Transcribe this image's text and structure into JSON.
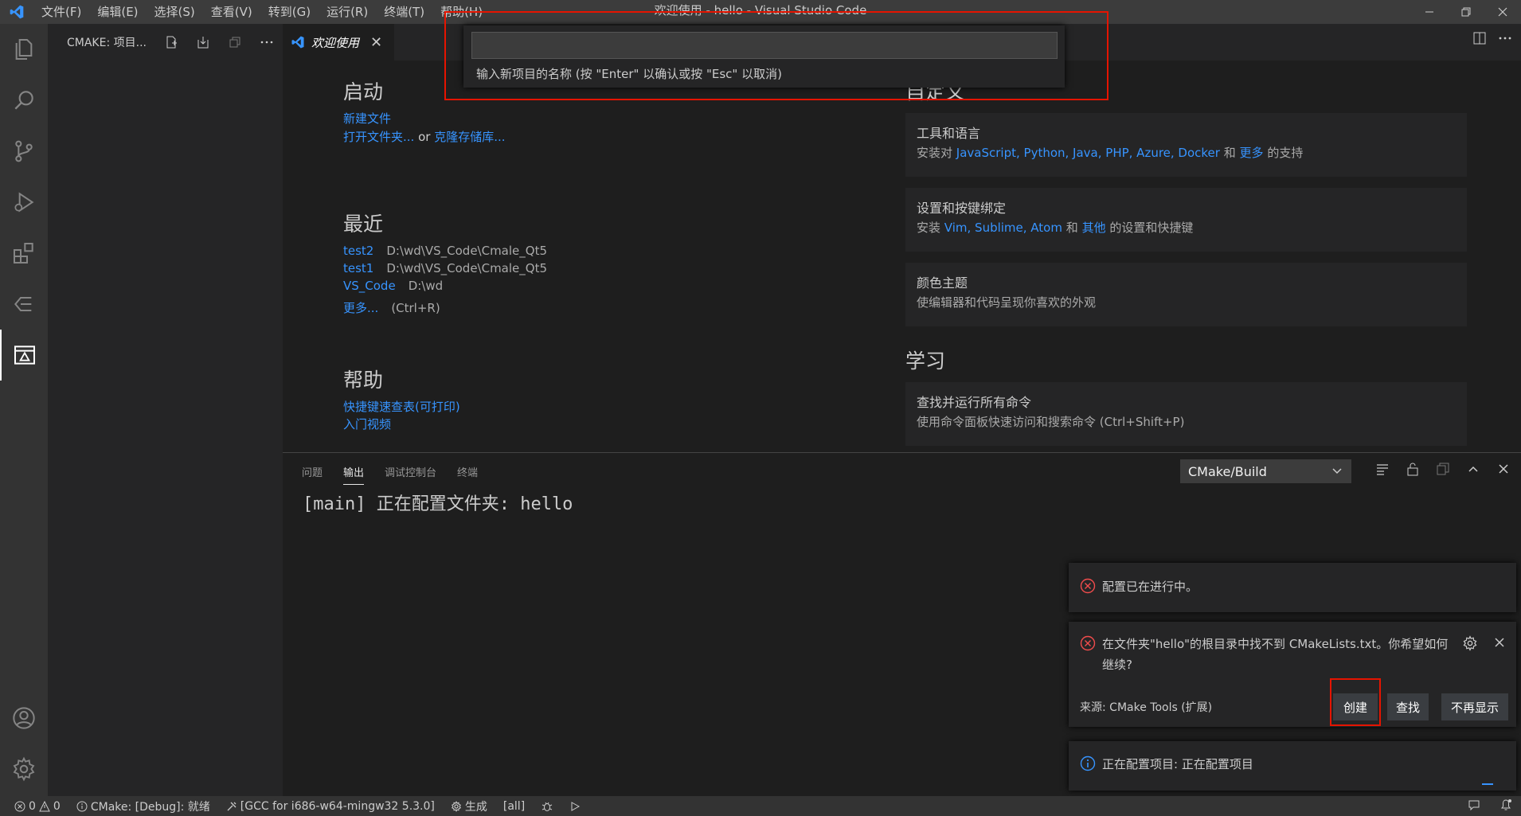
{
  "titlebar": {
    "title": "欢迎使用 - hello - Visual Studio Code",
    "menu": [
      "文件(F)",
      "编辑(E)",
      "选择(S)",
      "查看(V)",
      "转到(G)",
      "运行(R)",
      "终端(T)",
      "帮助(H)"
    ]
  },
  "sidebar": {
    "title": "CMAKE: 项目..."
  },
  "tab": {
    "label": "欢迎使用"
  },
  "quick_input": {
    "value": "",
    "message": "输入新项目的名称 (按 \"Enter\" 以确认或按 \"Esc\" 以取消)"
  },
  "welcome": {
    "start": {
      "title": "启动",
      "new_file": "新建文件",
      "open_folder": "打开文件夹...",
      "or": "or",
      "clone_repo": "克隆存储库..."
    },
    "recent": {
      "title": "最近",
      "items": [
        {
          "name": "test2",
          "path": "D:\\wd\\VS_Code\\Cmale_Qt5"
        },
        {
          "name": "test1",
          "path": "D:\\wd\\VS_Code\\Cmale_Qt5"
        },
        {
          "name": "VS_Code",
          "path": "D:\\wd"
        }
      ],
      "more": "更多...",
      "more_shortcut": "(Ctrl+R)"
    },
    "help": {
      "title": "帮助",
      "cheatsheet": "快捷键速查表(可打印)",
      "intro_videos": "入门视频"
    },
    "customize": {
      "title": "自定义",
      "cards": [
        {
          "title": "工具和语言",
          "desc_prefix": "安装对",
          "links": "JavaScript, Python, Java, PHP, Azure, Docker",
          "and": "和",
          "more": "更多",
          "desc_suffix": "的支持"
        },
        {
          "title": "设置和按键绑定",
          "desc_prefix": "安装",
          "links": "Vim, Sublime, Atom",
          "and": "和",
          "more": "其他",
          "desc_suffix": "的设置和快捷键"
        },
        {
          "title": "颜色主题",
          "desc": "使编辑器和代码呈现你喜欢的外观"
        }
      ]
    },
    "learn": {
      "title": "学习",
      "cards": [
        {
          "title": "查找并运行所有命令",
          "desc": "使用命令面板快速访问和搜索命令 (Ctrl+Shift+P)"
        }
      ]
    }
  },
  "panel": {
    "tabs": [
      "问题",
      "输出",
      "调试控制台",
      "终端"
    ],
    "active_tab": "输出",
    "channel": "CMake/Build",
    "output": "[main] 正在配置文件夹: hello"
  },
  "notifications": {
    "n1": {
      "text": "配置已在进行中。"
    },
    "n2": {
      "line1": "在文件夹\"hello\"的根目录中找不到 CMakeLists.txt。你希望如何",
      "line2": "继续?",
      "source": "来源: CMake Tools (扩展)",
      "buttons": {
        "create": "创建",
        "find": "查找",
        "dont_show": "不再显示"
      }
    },
    "n3": {
      "text": "正在配置项目: 正在配置项目"
    }
  },
  "statusbar": {
    "errors": "0",
    "warnings": "0",
    "cmake_status": "CMake: [Debug]: 就绪",
    "kit": "[GCC for i686-w64-mingw32 5.3.0]",
    "build": "生成",
    "target": "[all]"
  },
  "colors": {
    "accent": "#3794ff",
    "highlight": "#e51400",
    "error": "#f14c4c",
    "info": "#3794ff"
  }
}
